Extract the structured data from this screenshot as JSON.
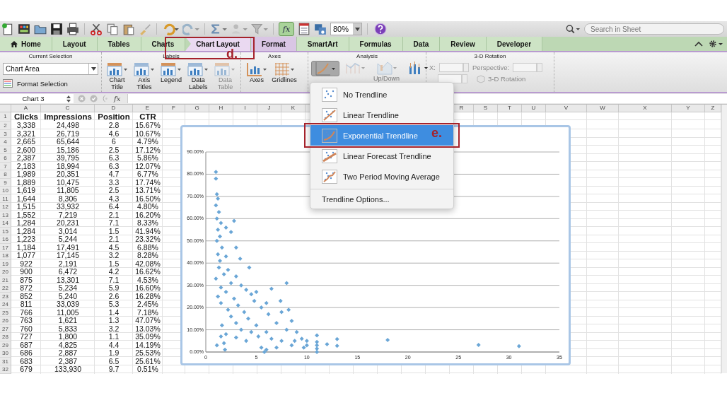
{
  "toolbar": {
    "zoom": "80%",
    "function_button": "fx",
    "search": {
      "placeholder": "Search in Sheet"
    }
  },
  "tabs": [
    {
      "label": "Home",
      "kind": "home",
      "selected": false
    },
    {
      "label": "Layout",
      "kind": "normal",
      "selected": false
    },
    {
      "label": "Tables",
      "kind": "normal",
      "selected": false
    },
    {
      "label": "Charts",
      "kind": "normal",
      "selected": false
    },
    {
      "label": "Chart Layout",
      "kind": "contextual",
      "selected": true
    },
    {
      "label": "Format",
      "kind": "contextual",
      "selected": false
    },
    {
      "label": "SmartArt",
      "kind": "normal",
      "selected": false
    },
    {
      "label": "Formulas",
      "kind": "normal",
      "selected": false
    },
    {
      "label": "Data",
      "kind": "normal",
      "selected": false
    },
    {
      "label": "Review",
      "kind": "normal",
      "selected": false
    },
    {
      "label": "Developer",
      "kind": "normal",
      "selected": false
    }
  ],
  "ribbon": {
    "current_selection": {
      "title": "Current Selection",
      "dropdown": "Chart Area",
      "button": "Format Selection"
    },
    "labels": {
      "title": "Labels",
      "buttons": [
        {
          "label": "Chart Title",
          "disabled": false
        },
        {
          "label": "Axis Titles",
          "disabled": false
        },
        {
          "label": "Legend",
          "disabled": false
        },
        {
          "label": "Data Labels",
          "disabled": false
        },
        {
          "label": "Data Table",
          "disabled": true
        }
      ]
    },
    "axes": {
      "title": "Axes",
      "buttons": [
        {
          "label": "Axes",
          "disabled": false
        },
        {
          "label": "Gridlines",
          "disabled": false
        }
      ]
    },
    "analysis": {
      "title": "Analysis",
      "buttons": [
        {
          "kind": "trendline",
          "selected": true,
          "disabled": false
        },
        {
          "kind": "lines",
          "selected": false,
          "disabled": true
        },
        {
          "kind": "updown",
          "label": "Up/Down",
          "selected": false,
          "disabled": true
        },
        {
          "kind": "errorbars",
          "selected": false,
          "disabled": false
        }
      ]
    },
    "rotation": {
      "title": "3-D Rotation",
      "disabled": true,
      "x_label": "X:",
      "perspective_label": "Perspective:",
      "button": "3-D Rotation"
    }
  },
  "formula_bar": {
    "name_box": "Chart 3",
    "fx": "fx"
  },
  "sheet": {
    "columns": [
      "A",
      "C",
      "D",
      "E",
      "F",
      "G",
      "H",
      "I",
      "J",
      "K",
      "R",
      "S",
      "T",
      "U",
      "V",
      "W",
      "X",
      "Y",
      "Z"
    ],
    "header": {
      "number": "1",
      "cells": [
        "Clicks",
        "Impressions",
        "Position",
        "CTR"
      ]
    },
    "rows": [
      {
        "number": "2",
        "cells": [
          "3,338",
          "24,498",
          "2.8",
          "15.67%"
        ]
      },
      {
        "number": "3",
        "cells": [
          "3,321",
          "26,719",
          "4.6",
          "10.67%"
        ]
      },
      {
        "number": "4",
        "cells": [
          "2,665",
          "65,644",
          "6",
          "4.79%"
        ]
      },
      {
        "number": "5",
        "cells": [
          "2,600",
          "15,186",
          "2.5",
          "17.12%"
        ]
      },
      {
        "number": "6",
        "cells": [
          "2,387",
          "39,795",
          "6.3",
          "5.86%"
        ]
      },
      {
        "number": "7",
        "cells": [
          "2,183",
          "18,994",
          "6.3",
          "12.07%"
        ]
      },
      {
        "number": "8",
        "cells": [
          "1,989",
          "20,351",
          "4.7",
          "6.77%"
        ]
      },
      {
        "number": "9",
        "cells": [
          "1,889",
          "10,475",
          "3.3",
          "17.74%"
        ]
      },
      {
        "number": "10",
        "cells": [
          "1,619",
          "11,805",
          "2.5",
          "13.71%"
        ]
      },
      {
        "number": "11",
        "cells": [
          "1,644",
          "8,306",
          "4.3",
          "16.50%"
        ]
      },
      {
        "number": "12",
        "cells": [
          "1,515",
          "33,932",
          "6.4",
          "4.80%"
        ]
      },
      {
        "number": "13",
        "cells": [
          "1,552",
          "7,219",
          "2.1",
          "16.20%"
        ]
      },
      {
        "number": "14",
        "cells": [
          "1,284",
          "20,231",
          "7.1",
          "8.33%"
        ]
      },
      {
        "number": "15",
        "cells": [
          "1,284",
          "3,014",
          "1.5",
          "41.94%"
        ]
      },
      {
        "number": "16",
        "cells": [
          "1,223",
          "5,244",
          "2.1",
          "23.32%"
        ]
      },
      {
        "number": "17",
        "cells": [
          "1,184",
          "17,491",
          "4.5",
          "6.88%"
        ]
      },
      {
        "number": "18",
        "cells": [
          "1,077",
          "17,145",
          "3.2",
          "8.28%"
        ]
      },
      {
        "number": "19",
        "cells": [
          "922",
          "2,191",
          "1.5",
          "42.08%"
        ]
      },
      {
        "number": "20",
        "cells": [
          "900",
          "6,472",
          "4.2",
          "16.62%"
        ]
      },
      {
        "number": "21",
        "cells": [
          "875",
          "13,301",
          "7.1",
          "4.53%"
        ]
      },
      {
        "number": "22",
        "cells": [
          "872",
          "5,234",
          "5.9",
          "16.60%"
        ]
      },
      {
        "number": "23",
        "cells": [
          "852",
          "5,240",
          "2.6",
          "16.28%"
        ]
      },
      {
        "number": "24",
        "cells": [
          "811",
          "33,039",
          "5.3",
          "2.45%"
        ]
      },
      {
        "number": "25",
        "cells": [
          "766",
          "11,005",
          "1.4",
          "7.18%"
        ]
      },
      {
        "number": "26",
        "cells": [
          "763",
          "1,621",
          "1.3",
          "47.07%"
        ]
      },
      {
        "number": "27",
        "cells": [
          "760",
          "5,833",
          "3.2",
          "13.03%"
        ]
      },
      {
        "number": "28",
        "cells": [
          "727",
          "1,800",
          "1.1",
          "35.09%"
        ]
      },
      {
        "number": "29",
        "cells": [
          "687",
          "4,825",
          "4.4",
          "14.19%"
        ]
      },
      {
        "number": "30",
        "cells": [
          "686",
          "2,887",
          "1.9",
          "25.53%"
        ]
      },
      {
        "number": "31",
        "cells": [
          "683",
          "2,387",
          "6.5",
          "25.61%"
        ]
      },
      {
        "number": "32",
        "cells": [
          "679",
          "133,930",
          "9.7",
          "0.51%"
        ]
      }
    ]
  },
  "chart": {
    "chart_data": {
      "type": "scatter",
      "grid": true,
      "xlim": [
        0,
        35
      ],
      "ylim": [
        0,
        0.9
      ],
      "xticks": [
        0,
        5,
        10,
        15,
        20,
        25,
        30,
        35
      ],
      "yticks": [
        {
          "value": 0,
          "label": "0.00%"
        },
        {
          "value": 0.1,
          "label": "10.00%"
        },
        {
          "value": 0.2,
          "label": "20.00%"
        },
        {
          "value": 0.3,
          "label": "30.00%"
        },
        {
          "value": 0.4,
          "label": "40.00%"
        },
        {
          "value": 0.5,
          "label": "50.00%"
        },
        {
          "value": 0.6,
          "label": "60.00%"
        },
        {
          "value": 0.7,
          "label": "70.00%"
        },
        {
          "value": 0.8,
          "label": "80.00%"
        },
        {
          "value": 0.9,
          "label": "90.00%"
        }
      ],
      "x": [
        1,
        1,
        1.1,
        1.2,
        1,
        1.3,
        1.1,
        1.5,
        1.2,
        2,
        1.4,
        2.8,
        2.5,
        1.1,
        1.6,
        3,
        1.2,
        2,
        1.4,
        3.4,
        1.3,
        2.2,
        1.8,
        4.3,
        1,
        3,
        2.5,
        1.5,
        3.5,
        2,
        4,
        1.2,
        2.8,
        4.5,
        5,
        1.5,
        3.2,
        4.8,
        6,
        2.2,
        3.8,
        5.5,
        7.4,
        8,
        6.5,
        2.5,
        4.2,
        6.2,
        7.5,
        8.2,
        3,
        5,
        7,
        8.5,
        1.6,
        2,
        3.5,
        4.5,
        6,
        8,
        9,
        1.5,
        3,
        4,
        5.2,
        6.5,
        7.5,
        8.8,
        9.5,
        10,
        1.1,
        1.8,
        5.5,
        6,
        7,
        8.5,
        9.7,
        10,
        1.9,
        5.8,
        11,
        11,
        11,
        11,
        11,
        12,
        13,
        13,
        18,
        27,
        31
      ],
      "series": [
        {
          "color": "#6aa6d6",
          "values": [
            0.81,
            0.78,
            0.71,
            0.69,
            0.66,
            0.63,
            0.6,
            0.58,
            0.55,
            0.56,
            0.52,
            0.59,
            0.54,
            0.5,
            0.47,
            0.47,
            0.44,
            0.43,
            0.41,
            0.42,
            0.38,
            0.37,
            0.35,
            0.38,
            0.33,
            0.34,
            0.31,
            0.29,
            0.3,
            0.27,
            0.28,
            0.25,
            0.24,
            0.26,
            0.27,
            0.22,
            0.21,
            0.23,
            0.22,
            0.19,
            0.18,
            0.2,
            0.23,
            0.31,
            0.285,
            0.16,
            0.15,
            0.17,
            0.18,
            0.19,
            0.13,
            0.12,
            0.13,
            0.14,
            0.12,
            0.08,
            0.1,
            0.09,
            0.09,
            0.1,
            0.09,
            0.07,
            0.065,
            0.05,
            0.07,
            0.06,
            0.05,
            0.05,
            0.06,
            0.05,
            0.03,
            0.04,
            0.02,
            0.01,
            0.02,
            0.03,
            0.02,
            0.03,
            0.01,
            0,
            0.075,
            0.045,
            0.03,
            0.015,
            0,
            0.035,
            0.058,
            0.028,
            0.054,
            0.032,
            0.026
          ]
        }
      ]
    }
  },
  "trendline_menu": {
    "items": [
      {
        "label": "No Trendline",
        "kind": "none",
        "selected": false
      },
      {
        "label": "Linear Trendline",
        "kind": "linear",
        "selected": false
      },
      {
        "label": "Exponential Trendline",
        "kind": "exponential",
        "selected": true
      },
      {
        "label": "Linear Forecast Trendline",
        "kind": "forecast",
        "selected": false
      },
      {
        "label": "Two Period Moving Average",
        "kind": "moving_average",
        "selected": false
      }
    ],
    "options": "Trendline Options..."
  },
  "annotations": [
    {
      "label": "d."
    },
    {
      "label": "e."
    }
  ]
}
